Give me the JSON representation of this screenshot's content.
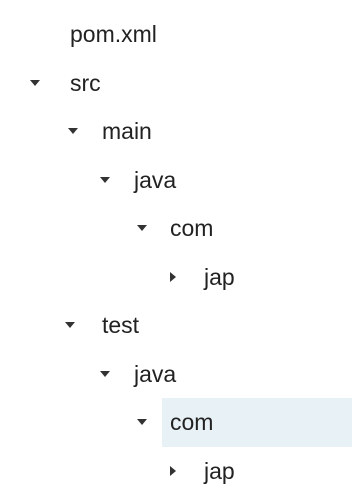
{
  "tree": {
    "nodes": [
      {
        "label": "pom.xml",
        "state": "leaf"
      },
      {
        "label": "src",
        "state": "expanded"
      },
      {
        "label": "main",
        "state": "expanded"
      },
      {
        "label": "java",
        "state": "expanded"
      },
      {
        "label": "com",
        "state": "expanded"
      },
      {
        "label": "jap",
        "state": "collapsed"
      },
      {
        "label": "test",
        "state": "expanded"
      },
      {
        "label": "java",
        "state": "expanded"
      },
      {
        "label": "com",
        "state": "expanded",
        "selected": true
      },
      {
        "label": "jap",
        "state": "collapsed"
      }
    ]
  },
  "colors": {
    "text": "#222222",
    "arrow": "#333333",
    "selection": "#e8f1f6"
  },
  "icons": {
    "expanded": "caret-down-icon",
    "collapsed": "caret-right-icon"
  }
}
